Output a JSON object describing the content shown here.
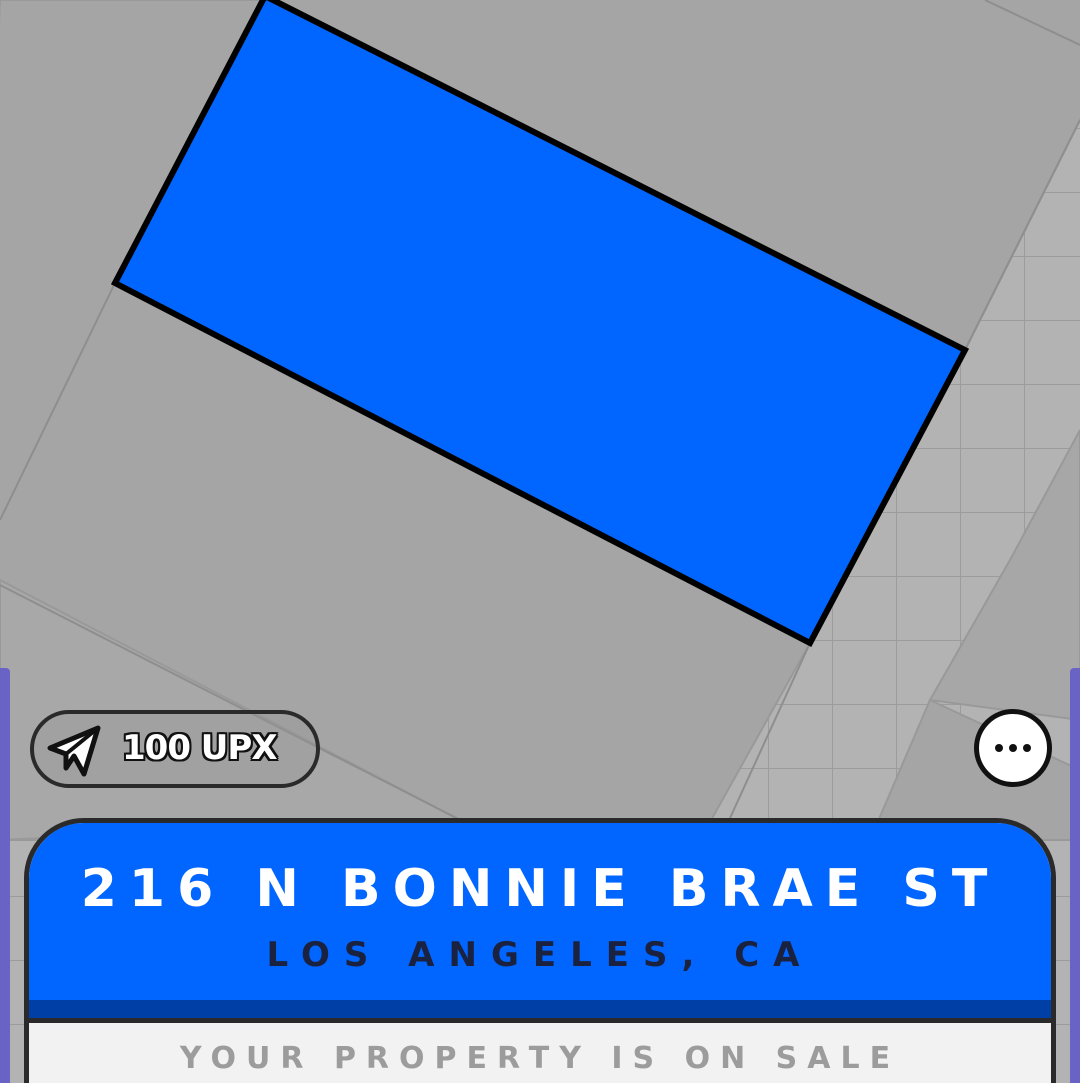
{
  "map": {
    "background_color": "#b3b3b3",
    "parcel_color": "#a5a5a5",
    "selected_parcel_color": "#0066ff",
    "grid_line_color": "#9a9a9a"
  },
  "price_pill": {
    "icon": "send-icon",
    "label": "100 UPX"
  },
  "more_button": {
    "icon": "more-horizontal-icon"
  },
  "property": {
    "street": "216 N BONNIE BRAE ST",
    "city_state": "LOS ANGELES, CA",
    "status": "YOUR PROPERTY IS ON SALE",
    "header_color": "#0066ff",
    "accent_strip_color": "#003fa6"
  }
}
